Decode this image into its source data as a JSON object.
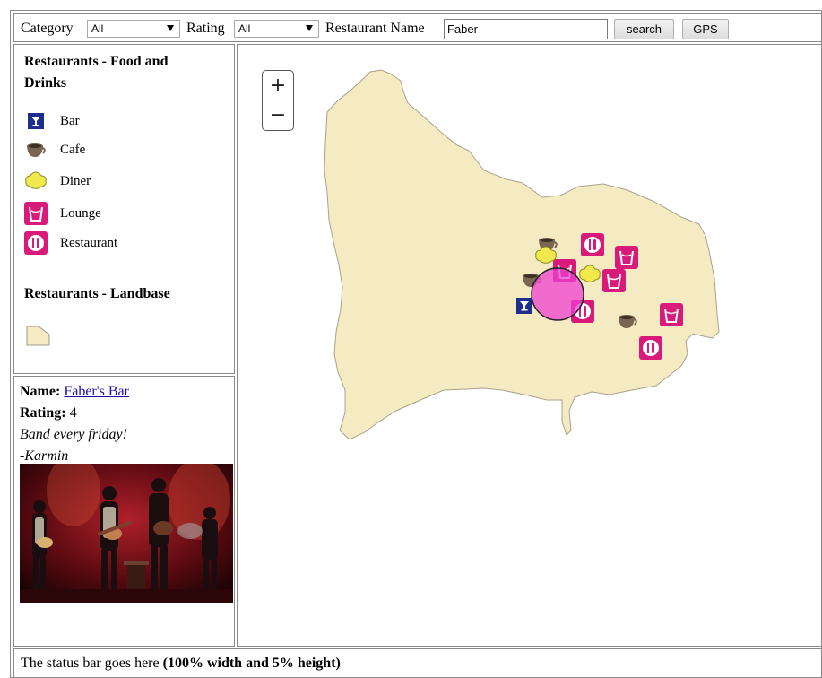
{
  "toolbar": {
    "category_label": "Category",
    "category_value": "All",
    "rating_label": "Rating",
    "rating_value": "All",
    "restaurant_name_label": "Restaurant Name",
    "restaurant_name_value": "Faber",
    "search_button": "search",
    "gps_button": "GPS"
  },
  "legend": {
    "food_title": "Restaurants - Food and Drinks",
    "items": [
      {
        "label": "Bar",
        "icon": "bar-icon"
      },
      {
        "label": "Cafe",
        "icon": "cafe-icon"
      },
      {
        "label": "Diner",
        "icon": "diner-icon"
      },
      {
        "label": "Lounge",
        "icon": "lounge-icon"
      },
      {
        "label": "Restaurant",
        "icon": "restaurant-icon"
      }
    ],
    "landbase_title": "Restaurants - Landbase"
  },
  "info": {
    "name_label": "Name:",
    "name_value": "Faber's Bar",
    "rating_label": "Rating:",
    "rating_value": "4",
    "comment": "Band every friday!",
    "author": "-Karmin"
  },
  "map": {
    "zoom_in": "+",
    "zoom_out": "−",
    "land_color": "#f5ebc3",
    "lounge_color": "#d81b7a",
    "bar_color": "#1c2f8c",
    "diner_color": "#f2ea4c"
  },
  "status": {
    "text": "The status bar goes here ",
    "bold_text": "(100% width and 5% height)"
  }
}
